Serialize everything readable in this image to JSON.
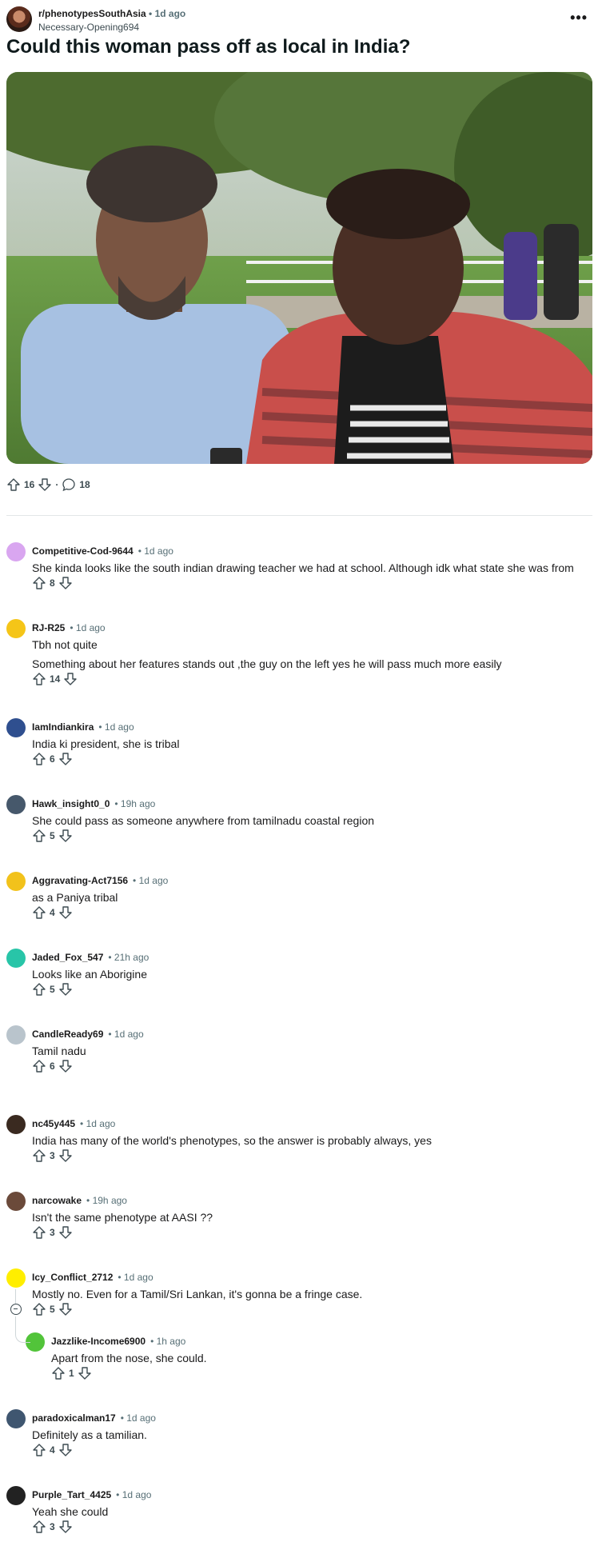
{
  "post": {
    "subreddit": "r/phenotypesSouthAsia",
    "separator": "•",
    "time": "1d ago",
    "author": "Necessary-Opening694",
    "more": "•••",
    "title": "Could this woman pass off as local in India?",
    "upvotes": "16",
    "dot": "·",
    "comments": "18"
  },
  "comments": [
    {
      "author": "Competitive-Cod-9644",
      "time": "• 1d ago",
      "text": "She kinda looks like the south indian drawing teacher we had at school. Although idk what state she was from",
      "votes": "8",
      "avatar_color": "#d9a6f0"
    },
    {
      "author": "RJ-R25",
      "time": "• 1d ago",
      "text": "Tbh not quite",
      "text2": "Something about her features stands out ,the guy on the left yes he will pass much more easily",
      "votes": "14",
      "avatar_color": "#f5c518"
    },
    {
      "author": "IamIndiankira",
      "time": "• 1d ago",
      "text": "India ki president, she is tribal",
      "votes": "6",
      "avatar_color": "#2f4f8f"
    },
    {
      "author": "Hawk_insight0_0",
      "time": "• 19h ago",
      "text": "She could pass as someone anywhere from tamilnadu coastal region",
      "votes": "5",
      "avatar_color": "#46586b"
    },
    {
      "author": "Aggravating-Act7156",
      "time": "• 1d ago",
      "text": "as a Paniya tribal",
      "votes": "4",
      "avatar_color": "#f2c21b"
    },
    {
      "author": "Jaded_Fox_547",
      "time": "• 21h ago",
      "text": "Looks like an Aborigine",
      "votes": "5",
      "avatar_color": "#28c5a8"
    },
    {
      "author": "CandleReady69",
      "time": "• 1d ago",
      "text": "Tamil nadu",
      "votes": "6",
      "avatar_color": "#b9c4cc"
    },
    {
      "author": "nc45y445",
      "time": "• 1d ago",
      "text": "India has many of the world's phenotypes, so the answer is probably always, yes",
      "votes": "3",
      "avatar_color": "#3a2a20"
    },
    {
      "author": "narcowake",
      "time": "• 19h ago",
      "text": "Isn't the same phenotype at AASI ??",
      "votes": "3",
      "avatar_color": "#6b4a3a"
    },
    {
      "author": "Icy_Conflict_2712",
      "time": "• 1d ago",
      "text": "Mostly no. Even for a Tamil/Sri Lankan, it's gonna be a fringe case.",
      "votes": "5",
      "avatar_color": "#ffee00"
    },
    {
      "author": "Jazzlike-Income6900",
      "time": "• 1h ago",
      "text": "Apart from the nose, she could.",
      "votes": "1",
      "avatar_color": "#52c43a"
    },
    {
      "author": "paradoxicalman17",
      "time": "• 1d ago",
      "text": "Definitely as a tamilian.",
      "votes": "4",
      "avatar_color": "#3f5670"
    },
    {
      "author": "Purple_Tart_4425",
      "time": "• 1d ago",
      "text": "Yeah she could",
      "votes": "3",
      "avatar_color": "#222222"
    }
  ],
  "icons": {
    "upvote": "upvote-arrow-icon",
    "downvote": "downvote-arrow-icon",
    "comment": "speech-bubble-icon",
    "collapse": "collapse-minus-icon"
  }
}
